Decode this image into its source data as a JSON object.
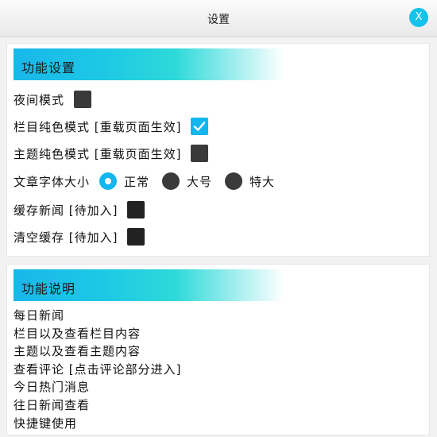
{
  "window": {
    "title": "设置",
    "close_label": "X"
  },
  "settings": {
    "header": "功能设置",
    "night_mode": {
      "label": "夜间模式",
      "checked": false
    },
    "column_solid_mode": {
      "label": "栏目纯色模式 [重载页面生效]",
      "checked": true
    },
    "theme_solid_mode": {
      "label": "主题纯色模式 [重载页面生效]",
      "checked": false
    },
    "font_size": {
      "label": "文章字体大小",
      "options": [
        "正常",
        "大号",
        "特大"
      ],
      "selected": "正常"
    },
    "cache_news": {
      "label": "缓存新闻 [待加入]",
      "checked": false
    },
    "clear_cache": {
      "label": "清空缓存 [待加入]",
      "checked": false
    }
  },
  "description": {
    "header": "功能说明",
    "items": [
      "每日新闻",
      "栏目以及查看栏目内容",
      "主题以及查看主题内容",
      "查看评论 [点击评论部分进入]",
      "今日热门消息",
      "往日新闻查看",
      "快捷键使用"
    ]
  },
  "colors": {
    "accent": "#13b6ee",
    "checkbox_off": "#3a3a3a"
  }
}
